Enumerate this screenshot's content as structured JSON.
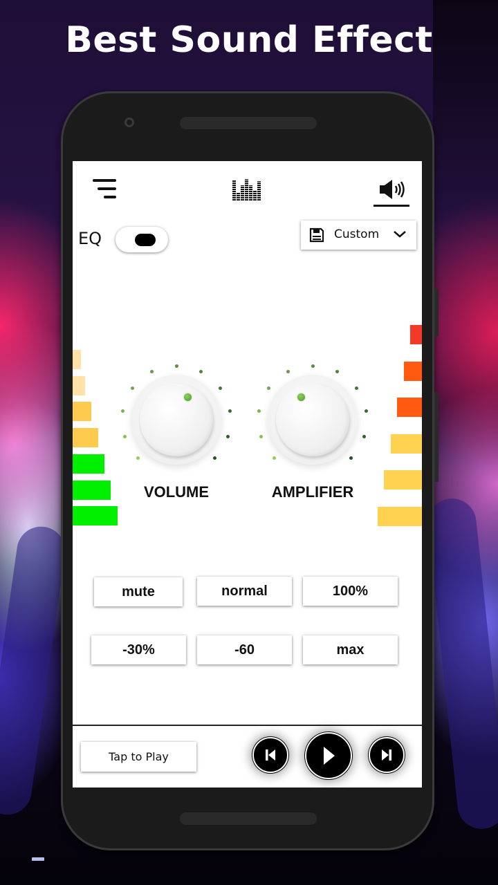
{
  "promo": {
    "headline": "Best Sound Effect"
  },
  "topbar": {
    "menu_icon": "menu-lines-icon",
    "equalizer_tab_icon": "equalizer-bars-icon",
    "speaker_tab_icon": "speaker-volume-icon",
    "active_tab": "speaker"
  },
  "eq": {
    "label": "EQ",
    "toggle_on": true
  },
  "preset": {
    "icon": "save-icon",
    "selected": "Custom",
    "chevron": "chevron-down-icon"
  },
  "meters": {
    "left": [
      {
        "level": 0.12,
        "color": "#ffe2a6"
      },
      {
        "level": 0.18,
        "color": "#ffe2a6"
      },
      {
        "level": 0.27,
        "color": "#ffcb4f"
      },
      {
        "level": 0.37,
        "color": "#ffcb4f"
      },
      {
        "level": 0.46,
        "color": "#00f000"
      },
      {
        "level": 0.55,
        "color": "#00f000"
      },
      {
        "level": 0.65,
        "color": "#00f000"
      }
    ],
    "right": [
      {
        "level": 0.17,
        "color": "#f3392a"
      },
      {
        "level": 0.26,
        "color": "#ff5a10"
      },
      {
        "level": 0.36,
        "color": "#ff5a10"
      },
      {
        "level": 0.45,
        "color": "#ffd24f"
      },
      {
        "level": 0.55,
        "color": "#ffd24f"
      },
      {
        "level": 0.64,
        "color": "#ffd24f"
      }
    ]
  },
  "knobs": [
    {
      "id": "volume",
      "label": "VOLUME",
      "value": 0.6
    },
    {
      "id": "amplifier",
      "label": "AMPLIFIER",
      "value": 0.4
    }
  ],
  "presets": [
    {
      "label": "mute"
    },
    {
      "label": "normal"
    },
    {
      "label": "100%"
    },
    {
      "label": "-30%"
    },
    {
      "label": "-60"
    },
    {
      "label": "max"
    }
  ],
  "player": {
    "tap_label": "Tap to Play",
    "prev_icon": "skip-previous-icon",
    "play_icon": "play-icon",
    "next_icon": "skip-next-icon"
  }
}
